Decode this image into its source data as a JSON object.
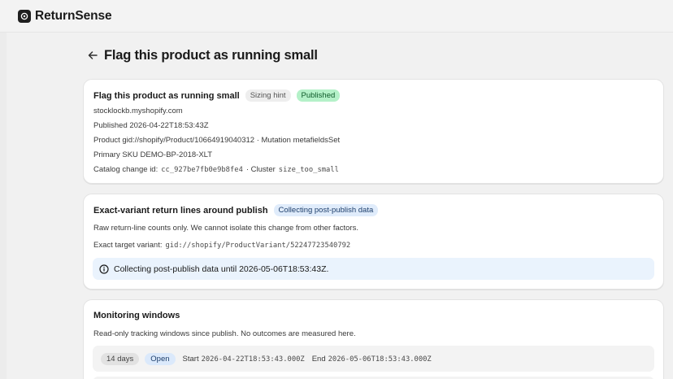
{
  "app": {
    "name": "ReturnSense"
  },
  "page": {
    "title": "Flag this product as running small"
  },
  "summary_card": {
    "title": "Flag this product as running small",
    "badges": [
      "Sizing hint",
      "Published"
    ],
    "shop": "stocklockb.myshopify.com",
    "published": "Published 2026-04-22T18:53:43Z",
    "product": "Product gid://shopify/Product/10664919040312 · Mutation metafieldsSet",
    "sku": "Primary SKU DEMO-BP-2018-XLT",
    "catalog_label": "Catalog change id:",
    "catalog_id": "cc_927be7fb0e9b8fe4",
    "cluster_label": "· Cluster",
    "cluster_value": "size_too_small"
  },
  "returns_card": {
    "title": "Exact-variant return lines around publish",
    "badge": "Collecting post-publish data",
    "description": "Raw return-line counts only. We cannot isolate this change from other factors.",
    "variant_label": "Exact target variant:",
    "variant_value": "gid://shopify/ProductVariant/52247723540792",
    "info": "Collecting post-publish data until 2026-05-06T18:53:43Z."
  },
  "monitoring_card": {
    "title": "Monitoring windows",
    "description": "Read-only tracking windows since publish. No outcomes are measured here.",
    "windows": [
      {
        "duration": "14 days",
        "status": "Open",
        "start_label": "Start",
        "start_value": "2026-04-22T18:53:43.000Z",
        "end_label": "End",
        "end_value": "2026-05-06T18:53:43.000Z"
      }
    ]
  },
  "colors": {
    "published_badge": "#b4f1c8",
    "info_background": "#eaf3fd",
    "page_background": "#f1f1f1"
  },
  "icons": [
    "returnsense-logo-icon",
    "back-arrow-icon",
    "info-icon"
  ]
}
